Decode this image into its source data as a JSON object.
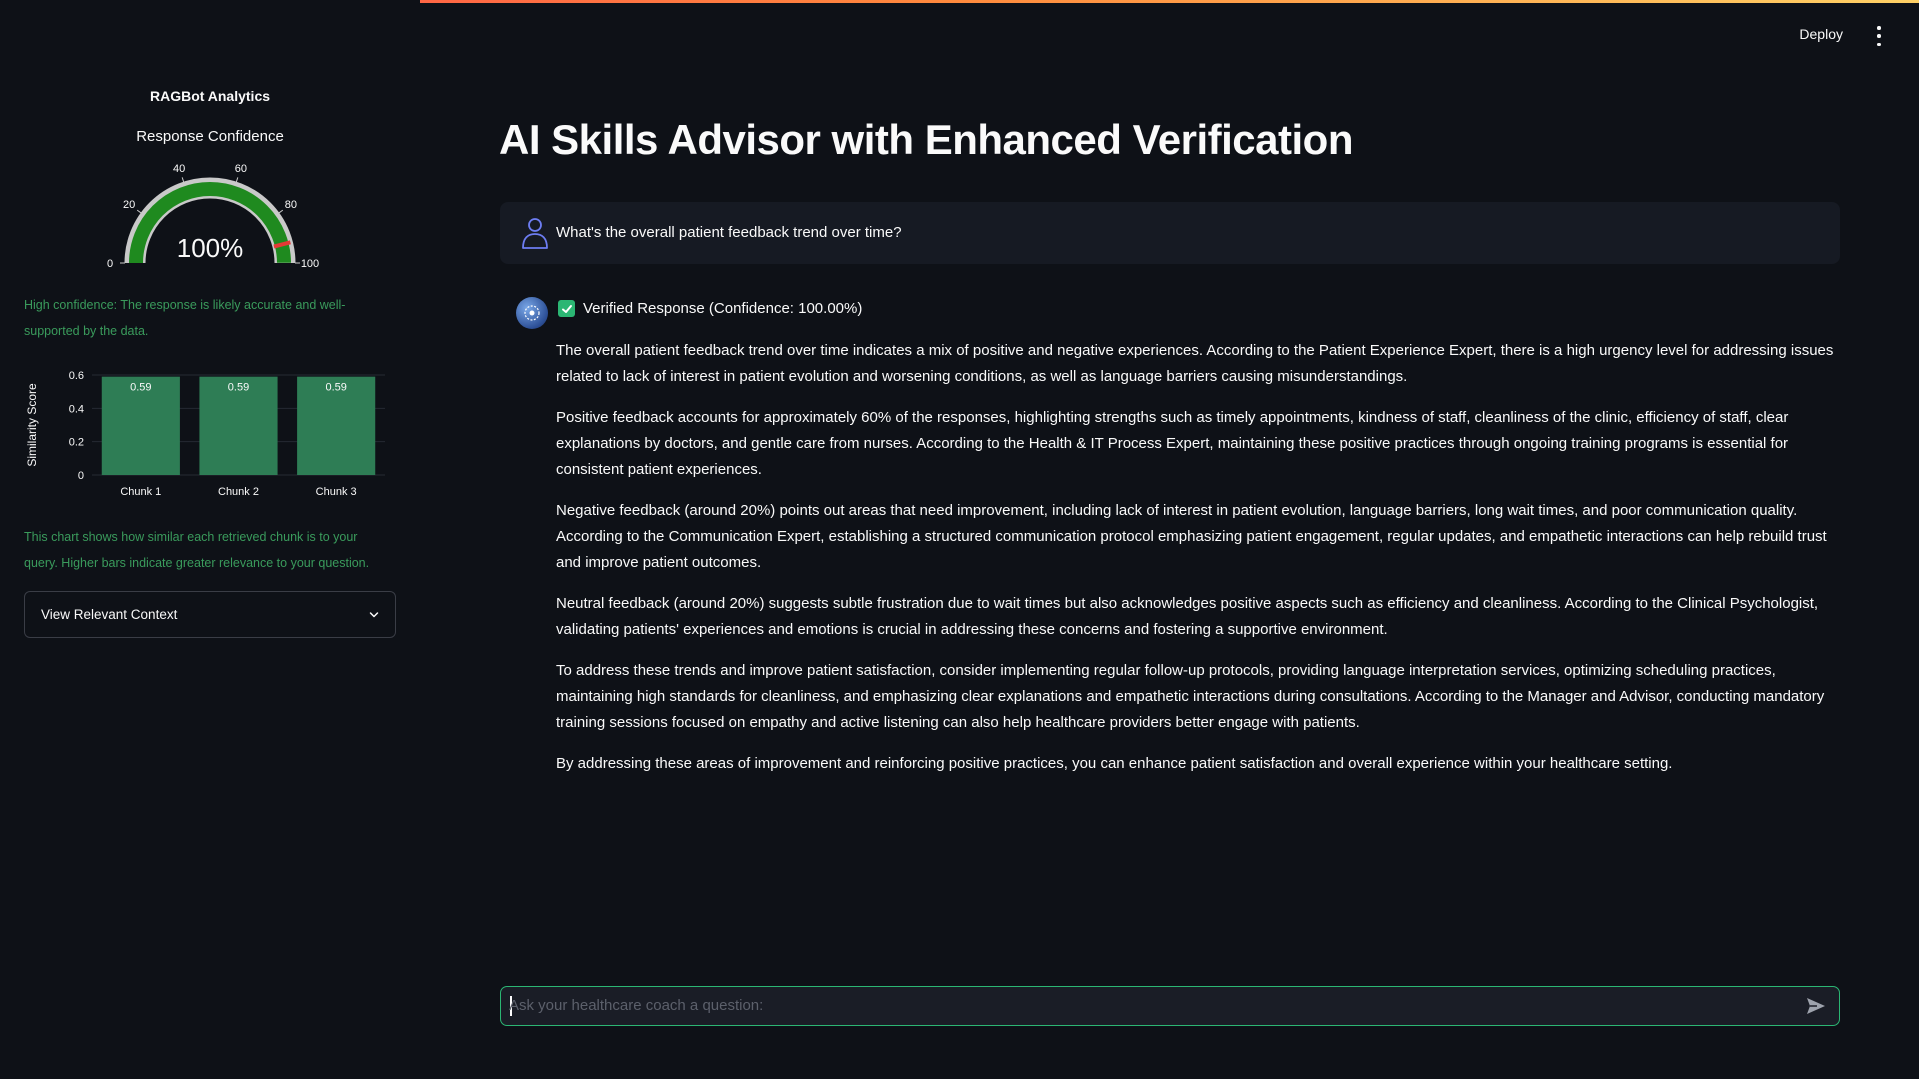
{
  "header": {
    "deploy_label": "Deploy"
  },
  "sidebar": {
    "title": "RAGBot Analytics",
    "gauge": {
      "title": "Response Confidence",
      "value_text": "100%",
      "value": 100,
      "ticks": [
        "0",
        "20",
        "40",
        "60",
        "80",
        "100"
      ],
      "bar_color": "#1f8a1f",
      "threshold_color": "#e53935"
    },
    "gauge_caption": "High confidence: The response is likely accurate and well-supported by the data.",
    "bar_caption": "This chart shows how similar each retrieved chunk is to your query. Higher bars indicate greater relevance to your question.",
    "expander_label": "View Relevant Context"
  },
  "chart_data": {
    "type": "bar",
    "categories": [
      "Chunk 1",
      "Chunk 2",
      "Chunk 3"
    ],
    "values": [
      0.59,
      0.59,
      0.59
    ],
    "data_labels": [
      "0.59",
      "0.59",
      "0.59"
    ],
    "xlabel": "",
    "ylabel": "Similarity Score",
    "ylim": [
      0,
      0.6
    ],
    "yticks": [
      "0",
      "0.2",
      "0.4",
      "0.6"
    ],
    "bar_color": "#2e7d55",
    "grid": true
  },
  "main": {
    "title": "AI Skills Advisor with Enhanced Verification",
    "user_message": "What's the overall patient feedback trend over time?",
    "bot_header": "Verified Response (Confidence: 100.00%)",
    "paragraphs": [
      "The overall patient feedback trend over time indicates a mix of positive and negative experiences. According to the Patient Experience Expert, there is a high urgency level for addressing issues related to lack of interest in patient evolution and worsening conditions, as well as language barriers causing misunderstandings.",
      "Positive feedback accounts for approximately 60% of the responses, highlighting strengths such as timely appointments, kindness of staff, cleanliness of the clinic, efficiency of staff, clear explanations by doctors, and gentle care from nurses. According to the Health & IT Process Expert, maintaining these positive practices through ongoing training programs is essential for consistent patient experiences.",
      "Negative feedback (around 20%) points out areas that need improvement, including lack of interest in patient evolution, language barriers, long wait times, and poor communication quality. According to the Communication Expert, establishing a structured communication protocol emphasizing patient engagement, regular updates, and empathetic interactions can help rebuild trust and improve patient outcomes.",
      "Neutral feedback (around 20%) suggests subtle frustration due to wait times but also acknowledges positive aspects such as efficiency and cleanliness. According to the Clinical Psychologist, validating patients' experiences and emotions is crucial in addressing these concerns and fostering a supportive environment.",
      "To address these trends and improve patient satisfaction, consider implementing regular follow-up protocols, providing language interpretation services, optimizing scheduling practices, maintaining high standards for cleanliness, and emphasizing clear explanations and empathetic interactions during consultations. According to the Manager and Advisor, conducting mandatory training sessions focused on empathy and active listening can also help healthcare providers better engage with patients.",
      "By addressing these areas of improvement and reinforcing positive practices, you can enhance patient satisfaction and overall experience within your healthcare setting."
    ]
  },
  "chat_input": {
    "placeholder": "Ask your healthcare coach a question:",
    "value": ""
  }
}
